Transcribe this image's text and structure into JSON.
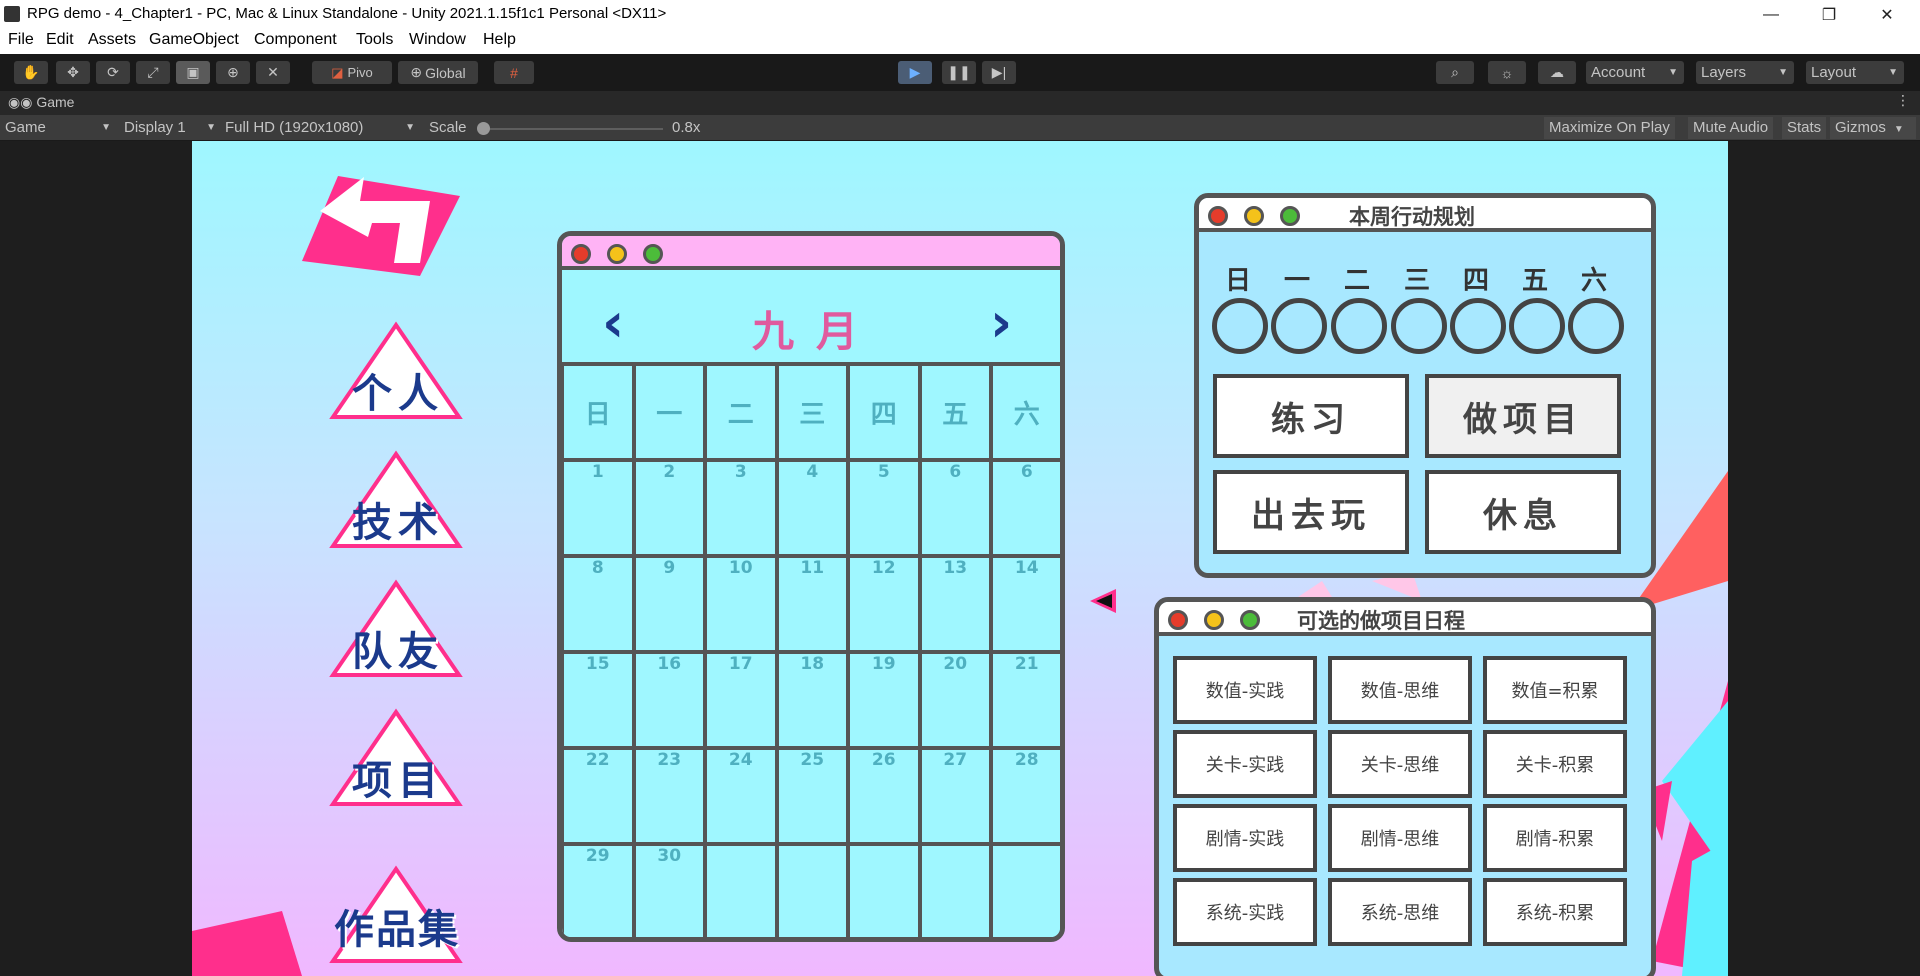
{
  "window": {
    "title": "RPG demo - 4_Chapter1 - PC, Mac & Linux Standalone - Unity 2021.1.15f1c1 Personal <DX11>",
    "minimize": "—",
    "restore": "❐",
    "close": "✕"
  },
  "menu": [
    "File",
    "Edit",
    "Assets",
    "GameObject",
    "Component",
    "Tools",
    "Window",
    "Help"
  ],
  "toolbar": {
    "pivot_label": "Pivo",
    "global_label": "Global",
    "account_label": "Account",
    "layers_label": "Layers",
    "layout_label": "Layout"
  },
  "game_tab": {
    "tab_label": "Game",
    "view_select": "Game",
    "display_select": "Display 1",
    "resolution_select": "Full HD (1920x1080)",
    "scale_label": "Scale",
    "scale_value": "0.8x",
    "maximize_label": "Maximize On Play",
    "mute_label": "Mute Audio",
    "stats_label": "Stats",
    "gizmos_label": "Gizmos"
  },
  "nav": [
    "个人",
    "技术",
    "队友",
    "项目",
    "作品集"
  ],
  "calendar": {
    "month": "九月",
    "prev": "‹",
    "next": "›",
    "weekdays": [
      "日",
      "一",
      "二",
      "三",
      "四",
      "五",
      "六"
    ],
    "days": [
      "1",
      "2",
      "3",
      "4",
      "5",
      "6",
      "6",
      "8",
      "9",
      "10",
      "11",
      "12",
      "13",
      "14",
      "15",
      "16",
      "17",
      "18",
      "19",
      "20",
      "21",
      "22",
      "23",
      "24",
      "25",
      "26",
      "27",
      "28",
      "29",
      "30"
    ]
  },
  "plan": {
    "title": "本周行动规划",
    "weekdays": [
      "日",
      "一",
      "二",
      "三",
      "四",
      "五",
      "六"
    ],
    "actions": [
      "练习",
      "做项目",
      "出去玩",
      "休息"
    ]
  },
  "options": {
    "title": "可选的做项目日程",
    "items": [
      "数值-实践",
      "数值-思维",
      "数值=积累",
      "关卡-实践",
      "关卡-思维",
      "关卡-积累",
      "剧情-实践",
      "剧情-思维",
      "剧情-积累",
      "系统-实践",
      "系统-思维",
      "系统-积累"
    ]
  },
  "colors": {
    "accent_pink": "#ff2f8c",
    "calendar_bg": "#9ff7ff",
    "navy": "#1b3a8c"
  }
}
